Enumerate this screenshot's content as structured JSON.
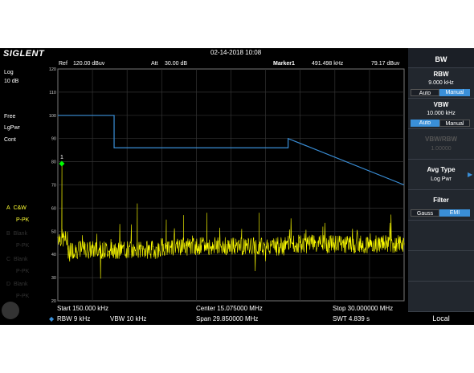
{
  "header": {
    "logo": "SIGLENT",
    "datetime": "02-14-2018 10:08"
  },
  "info": {
    "ref_label": "Ref",
    "ref_value": "120.00 dBuv",
    "att_label": "Att",
    "att_value": "30.00 dB",
    "marker_label": "Marker1",
    "marker_freq": "491.498 kHz",
    "marker_level": "79.17 dBuv"
  },
  "left_panel": {
    "scale": "Log",
    "div": "10 dB",
    "mode1": "Free",
    "mode2": "LgPwr",
    "mode3": "Cont",
    "traces": [
      {
        "label": "A",
        "text": "C&W",
        "sub": "P-PK",
        "active": true
      },
      {
        "label": "B",
        "text": "Blank",
        "sub": "P-PK",
        "active": false
      },
      {
        "label": "C",
        "text": "Blank",
        "sub": "P-PK",
        "active": false
      },
      {
        "label": "D",
        "text": "Blank",
        "sub": "P-PK",
        "active": false
      }
    ]
  },
  "y_ticks": [
    "120",
    "110",
    "100",
    "90",
    "80",
    "70",
    "60",
    "50",
    "40",
    "30",
    "20"
  ],
  "marker_number": "1",
  "bottom": {
    "start": "Start  150.000 kHz",
    "center": "Center  15.075000 MHz",
    "stop": "Stop  30.000000 MHz",
    "rbw": "RBW  9 kHz",
    "vbw": "VBW  10 kHz",
    "span": "Span    29.850000 MHz",
    "swt": "SWT  4.839 s"
  },
  "right_panel": {
    "title": "BW",
    "rbw_title": "RBW",
    "rbw_value": "9.000 kHz",
    "rbw_auto": "Auto",
    "rbw_manual": "Manual",
    "vbw_title": "VBW",
    "vbw_value": "10.000 kHz",
    "vbw_auto": "Auto",
    "vbw_manual": "Manual",
    "ratio_title": "VBW/RBW",
    "ratio_value": "1.00000",
    "avg_title": "Avg Type",
    "avg_value": "Log Pwr",
    "filter_title": "Filter",
    "filter_gauss": "Gauss",
    "filter_emi": "EMI",
    "local": "Local"
  },
  "colors": {
    "trace": "#ffff00",
    "limit": "#3a8fd8",
    "marker": "#00ff00",
    "accent": "#3a8fd8"
  },
  "chart_data": {
    "type": "line",
    "x_unit": "MHz",
    "y_unit": "dBuv",
    "xlim": [
      0.15,
      30.0
    ],
    "ylim": [
      20,
      120
    ],
    "grid": true,
    "series": [
      {
        "name": "",
        "x": [
          0.15,
          0.5,
          1.0,
          2.5,
          4.0,
          5.0,
          6.5,
          7.0,
          8.0,
          9.5,
          10.5,
          11.0,
          12.5,
          13.0,
          14.0,
          15.5,
          16.0,
          17.5,
          18.0,
          20.0,
          21.0,
          23.0,
          25.0,
          27.0,
          30.0
        ],
        "y": [
          47,
          79.17,
          44,
          42,
          45,
          43,
          41,
          62,
          44,
          55,
          43,
          57,
          44,
          58,
          46,
          44,
          51,
          58,
          44,
          48,
          43,
          52,
          45,
          44,
          45
        ]
      },
      {
        "name": "",
        "x": [
          0.15,
          5.0,
          5.0,
          20.0,
          20.0,
          30.0
        ],
        "y": [
          100,
          100,
          86,
          86,
          90,
          70
        ]
      }
    ],
    "marker": {
      "x": 0.491,
      "y": 79.17
    }
  }
}
